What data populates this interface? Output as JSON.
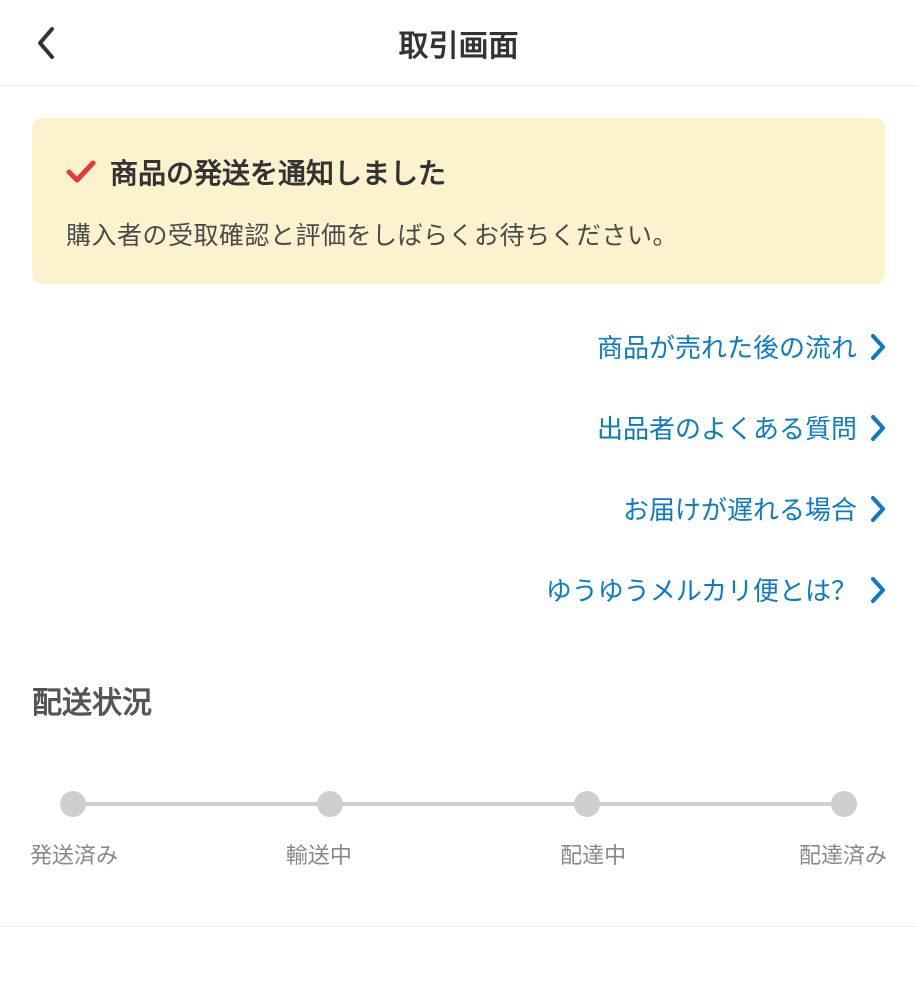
{
  "header": {
    "title": "取引画面"
  },
  "notice": {
    "title": "商品の発送を通知しました",
    "body": "購入者の受取確認と評価をしばらくお待ちください。"
  },
  "links": [
    {
      "label": "商品が売れた後の流れ"
    },
    {
      "label": "出品者のよくある質問"
    },
    {
      "label": "お届けが遅れる場合"
    },
    {
      "label": "ゆうゆうメルカリ便とは？"
    }
  ],
  "delivery": {
    "heading": "配送状況",
    "steps": [
      "発送済み",
      "輸送中",
      "配達中",
      "配達済み"
    ]
  },
  "colors": {
    "link": "#0d7bc4",
    "checkRed": "#e83a3a",
    "bannerBg": "#fdf2ce",
    "progressGrey": "#cfcfcf"
  }
}
